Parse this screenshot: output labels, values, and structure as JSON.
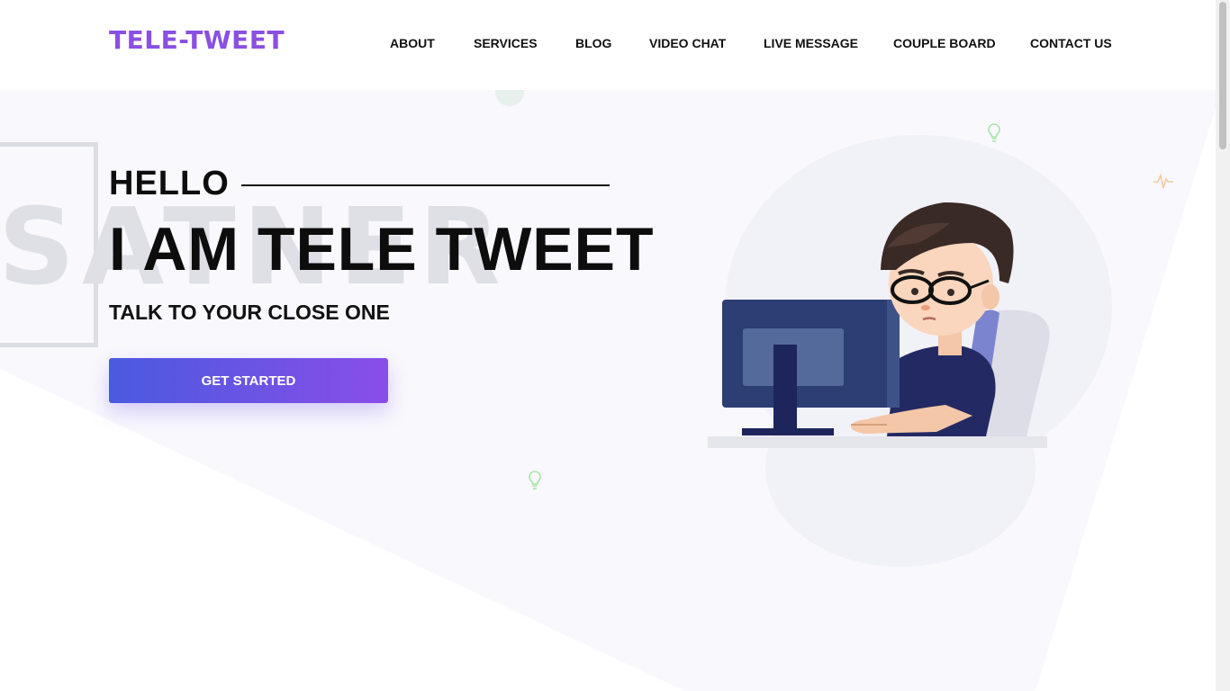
{
  "brand": {
    "logo_text": "TELE-TWEET",
    "accent_color": "#8a4fe3"
  },
  "nav": {
    "items": [
      {
        "label": "ABOUT"
      },
      {
        "label": "SERVICES"
      },
      {
        "label": "BLOG"
      },
      {
        "label": "VIDEO CHAT"
      },
      {
        "label": "LIVE MESSAGE"
      },
      {
        "label": "COUPLE BOARD"
      },
      {
        "label": "CONTACT US"
      }
    ]
  },
  "hero": {
    "watermark": "SATNER",
    "greeting": "HELLO",
    "title": "I AM TELE TWEET",
    "subtitle": "TALK TO YOUR CLOSE ONE",
    "cta_label": "GET STARTED",
    "cta_gradient": [
      "#4a5ae0",
      "#8a4ee8"
    ]
  },
  "decorations": {
    "icons": [
      "lightbulb-icon",
      "pulse-icon",
      "lightbulb-icon"
    ],
    "illustration": "boy-at-computer-illustration"
  }
}
